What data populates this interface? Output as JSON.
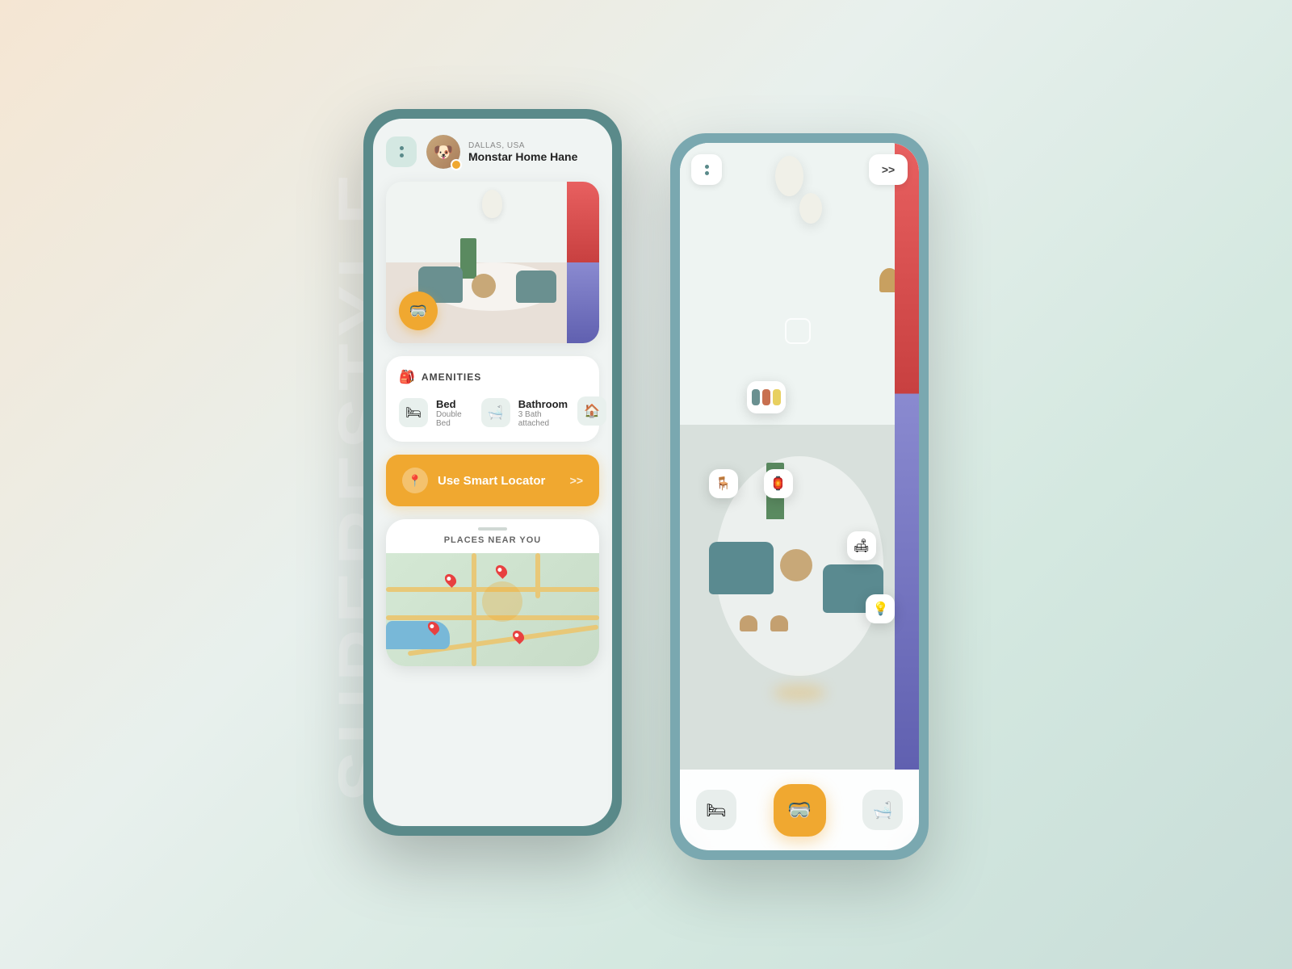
{
  "watermark": {
    "text": "SUPERFSTYLE"
  },
  "left_phone": {
    "header": {
      "location": "DALLAS, USA",
      "username": "Monstar Home Hane",
      "menu_label": "menu"
    },
    "room_image": {
      "vr_button_label": "VR"
    },
    "amenities": {
      "section_title": "AMENITIES",
      "section_icon": "🎒",
      "bed": {
        "name": "Bed",
        "detail": "Double Bed",
        "icon": "🛏"
      },
      "bathroom": {
        "name": "Bathroom",
        "detail": "3 Bath attached",
        "icon": "🛁"
      },
      "extra_icon": "🏠"
    },
    "smart_locator": {
      "label": "Use Smart Locator",
      "icon": "📍",
      "arrow": ">>"
    },
    "map": {
      "label": "PLACES NEAR YOU"
    }
  },
  "right_phone": {
    "ar_view": {
      "forward_btn_label": ">>",
      "menu_label": "menu"
    },
    "bottom_bar": {
      "bed_icon": "🛏",
      "vr_icon": "🥽",
      "bath_icon": "🛁"
    }
  },
  "colors": {
    "accent_orange": "#f0a830",
    "phone_teal": "#5a8a8a",
    "button_teal": "#d4e8e2",
    "white": "#ffffff",
    "swatch_1": "#6a9090",
    "swatch_2": "#c87050",
    "swatch_3": "#e8d060"
  }
}
